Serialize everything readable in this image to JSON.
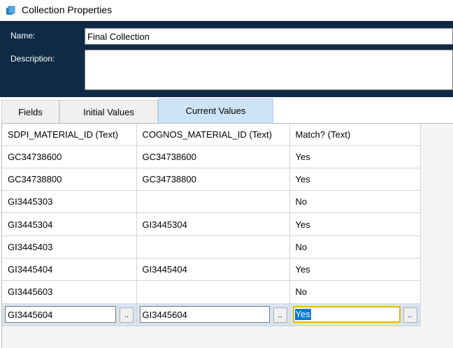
{
  "window": {
    "title": "Collection Properties"
  },
  "form": {
    "name_label": "Name:",
    "name_value": "Final Collection",
    "description_label": "Description:",
    "description_value": ""
  },
  "tabs": [
    {
      "label": "Fields",
      "active": false
    },
    {
      "label": "Initial Values",
      "active": false
    },
    {
      "label": "Current Values",
      "active": true
    }
  ],
  "grid": {
    "columns": [
      "SDPI_MATERIAL_ID  (Text)",
      "COGNOS_MATERIAL_ID  (Text)",
      "Match?  (Text)"
    ],
    "rows": [
      [
        "GC34738600",
        "GC34738600",
        "Yes"
      ],
      [
        "GC34738800",
        "GC34738800",
        "Yes"
      ],
      [
        "GI3445303",
        "",
        "No"
      ],
      [
        "GI3445304",
        "GI3445304",
        "Yes"
      ],
      [
        "GI3445403",
        "",
        "No"
      ],
      [
        "GI3445404",
        "GI3445404",
        "Yes"
      ],
      [
        "GI3445603",
        "",
        "No"
      ]
    ],
    "edit_row": [
      "GI3445604",
      "GI3445604",
      "Yes"
    ],
    "ellipsis_label": ".."
  },
  "colors": {
    "header_bg": "#0f2a47",
    "active_tab": "#cde4f7",
    "focus_border": "#f0b400"
  }
}
